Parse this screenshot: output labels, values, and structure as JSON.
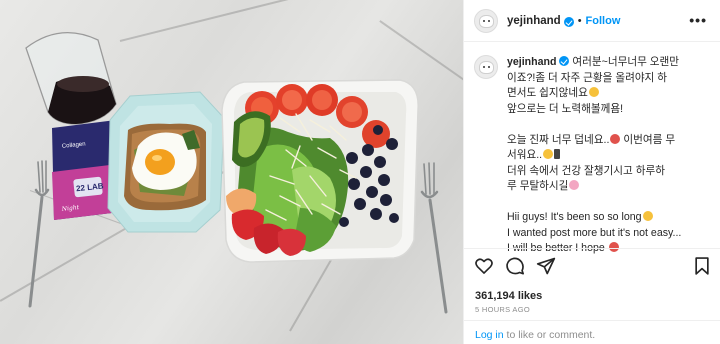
{
  "post": {
    "username": "yejinhand",
    "follow_label": "Follow",
    "separator": "•",
    "more_label": "•••",
    "caption": {
      "username": "yejinhand",
      "lines": [
        "여러분~너무너무 오랜만",
        "이죠?!좀 더 자주 근황을 올려야지 하",
        "면서도 쉽지않네요",
        "앞으로는 더 노력해볼께욤!",
        "",
        "오늘 진짜 너무 덥네요..",
        "이번여름 무",
        "서워요..",
        "더위 속에서 건강 잘챙기시고 하루하",
        "루 무탈하시길",
        "",
        "Hii guys! It's been so so long",
        "I wanted post more but it's not easy...",
        "I will be better I hope"
      ]
    },
    "likes": "361,194 likes",
    "timestamp": "5 HOURS AGO",
    "login_link": "Log in",
    "login_rest": " to like or comment."
  },
  "photo": {
    "pouch_brand": "22 LAB",
    "pouch_product": "Collagen",
    "pouch_script": "Night"
  },
  "colors": {
    "accent": "#0095f6",
    "text": "#262626",
    "muted": "#8e8e8e"
  },
  "icons": [
    "verified-badge-icon",
    "more-options-icon",
    "heart-icon",
    "comment-icon",
    "share-icon",
    "bookmark-icon"
  ]
}
